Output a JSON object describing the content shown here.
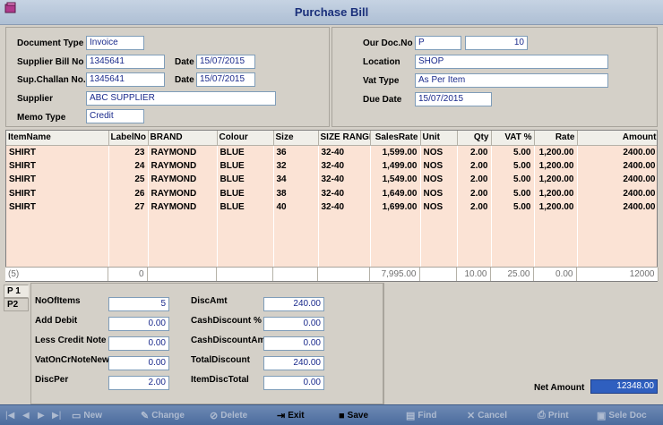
{
  "window": {
    "title": "Purchase Bill"
  },
  "header_left": {
    "document_type_label": "Document Type",
    "document_type": "Invoice",
    "supplier_bill_no_label": "Supplier Bill No",
    "supplier_bill_no": "1345641",
    "bill_date_label": "Date",
    "bill_date": "15/07/2015",
    "sup_challan_no_label": "Sup.Challan No.",
    "sup_challan_no": "1345641",
    "challan_date_label": "Date",
    "challan_date": "15/07/2015",
    "supplier_label": "Supplier",
    "supplier": "ABC SUPPLIER",
    "memo_type_label": "Memo Type",
    "memo_type": "Credit"
  },
  "header_right": {
    "our_doc_no_label": "Our Doc.No",
    "our_doc_prefix": "P",
    "our_doc_no": "10",
    "location_label": "Location",
    "location": "SHOP",
    "vat_type_label": "Vat Type",
    "vat_type": "As Per Item",
    "due_date_label": "Due Date",
    "due_date": "15/07/2015"
  },
  "grid": {
    "columns": [
      "ItemName",
      "LabelNo",
      "BRAND",
      "Colour",
      "Size",
      "SIZE RANGE",
      "SalesRate",
      "Unit",
      "Qty",
      "VAT %",
      "Rate",
      "Amount"
    ],
    "rows": [
      [
        "SHIRT",
        "23",
        "RAYMOND",
        "BLUE",
        "36",
        "32-40",
        "1,599.00",
        "NOS",
        "2.00",
        "5.00",
        "1,200.00",
        "2400.00"
      ],
      [
        "SHIRT",
        "24",
        "RAYMOND",
        "BLUE",
        "32",
        "32-40",
        "1,499.00",
        "NOS",
        "2.00",
        "5.00",
        "1,200.00",
        "2400.00"
      ],
      [
        "SHIRT",
        "25",
        "RAYMOND",
        "BLUE",
        "34",
        "32-40",
        "1,549.00",
        "NOS",
        "2.00",
        "5.00",
        "1,200.00",
        "2400.00"
      ],
      [
        "SHIRT",
        "26",
        "RAYMOND",
        "BLUE",
        "38",
        "32-40",
        "1,649.00",
        "NOS",
        "2.00",
        "5.00",
        "1,200.00",
        "2400.00"
      ],
      [
        "SHIRT",
        "27",
        "RAYMOND",
        "BLUE",
        "40",
        "32-40",
        "1,699.00",
        "NOS",
        "2.00",
        "5.00",
        "1,200.00",
        "2400.00"
      ]
    ],
    "totals": [
      "(5)",
      "0",
      "",
      "",
      "",
      "",
      "7,995.00",
      "",
      "10.00",
      "25.00",
      "0.00",
      "12000"
    ]
  },
  "tabs": [
    "P 1",
    "P2"
  ],
  "summary": {
    "no_of_items_label": "NoOfItems",
    "no_of_items": "5",
    "add_debit_label": "Add Debit",
    "add_debit": "0.00",
    "less_credit_note_label": "Less Credit Note",
    "less_credit_note": "0.00",
    "vat_on_cr_note_new_label": "VatOnCrNoteNew",
    "vat_on_cr_note_new": "0.00",
    "disc_per_label": "DiscPer",
    "disc_per": "2.00",
    "disc_amt_label": "DiscAmt",
    "disc_amt": "240.00",
    "cash_discount_pct_label": "CashDiscount %",
    "cash_discount_pct": "0.00",
    "cash_discount_amt_label": "CashDiscountAmt",
    "cash_discount_amt": "0.00",
    "total_discount_label": "TotalDiscount",
    "total_discount": "240.00",
    "item_disc_total_label": "ItemDiscTotal",
    "item_disc_total": "0.00",
    "net_amount_label": "Net Amount",
    "net_amount": "12348.00"
  },
  "toolbar": {
    "first": "|◀",
    "prev": "◀",
    "next": "▶",
    "last": "▶|",
    "new": "New",
    "change": "Change",
    "delete": "Delete",
    "exit": "Exit",
    "save": "Save",
    "find": "Find",
    "cancel": "Cancel",
    "print": "Print",
    "sele_doc": "Sele Doc"
  },
  "colors": {
    "title_text": "#1a2f7a",
    "field_text": "#1a2a8c",
    "grid_background": "#fbe3d5",
    "net_amount_background": "#2f5fbf",
    "toolbar_background": "#5a78a6"
  }
}
